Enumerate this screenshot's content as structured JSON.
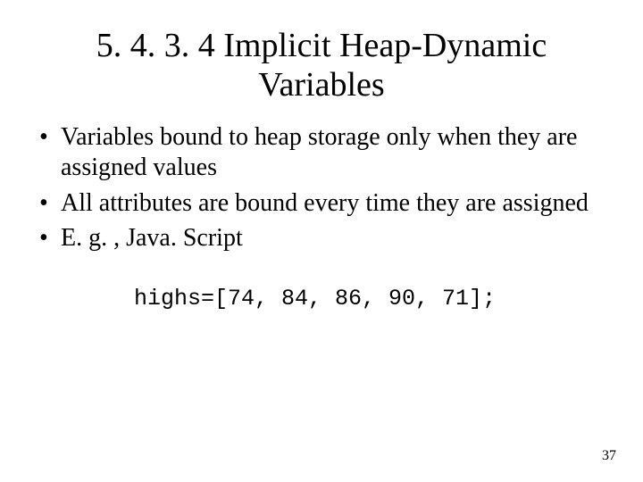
{
  "title_line1": "5. 4. 3. 4 Implicit Heap-Dynamic",
  "title_line2": "Variables",
  "bullets": [
    "Variables bound to heap storage only when they are assigned values",
    "All attributes are bound every time they are assigned",
    "E. g. , Java. Script"
  ],
  "code": "highs=[74, 84, 86, 90, 71];",
  "page_number": "37"
}
